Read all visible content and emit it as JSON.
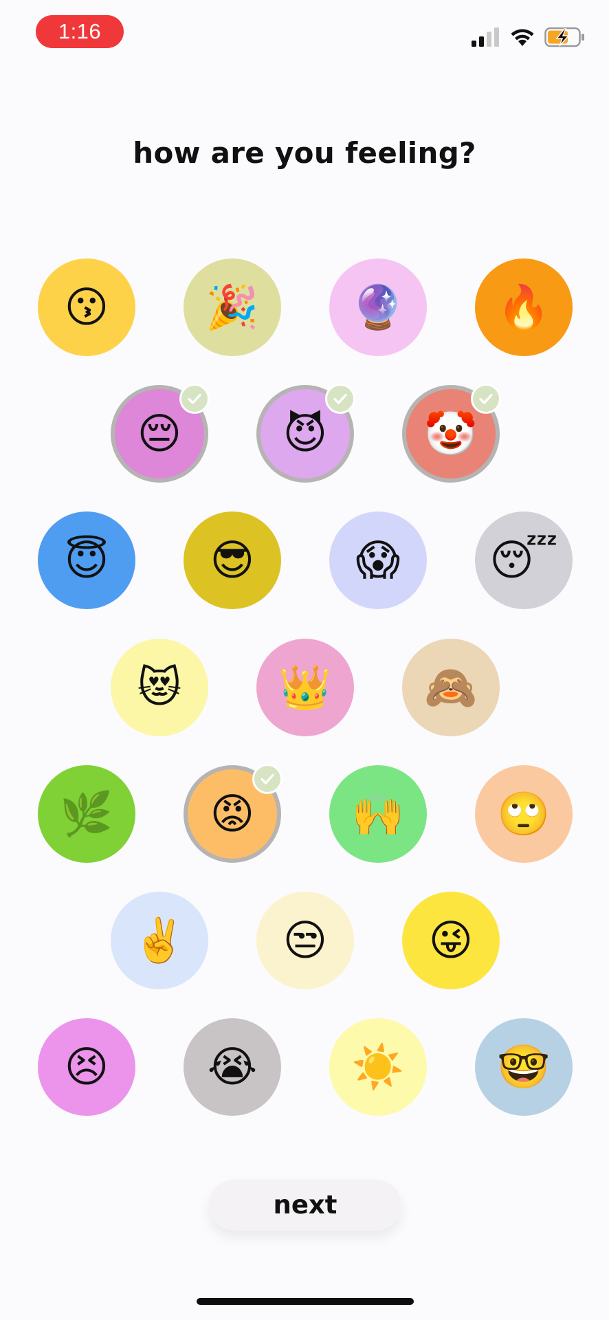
{
  "status_bar": {
    "time": "1:16",
    "signal_icon": "cellular-signal-icon",
    "wifi_icon": "wifi-icon",
    "battery_icon": "battery-charging-icon",
    "battery_color": "#f5a623"
  },
  "title": "how are you feeling?",
  "moods": [
    {
      "emoji": "😗",
      "name": "kissing-face",
      "color": "#fdd249",
      "selected": false
    },
    {
      "emoji": "🎉",
      "name": "party-popper",
      "color": "#dede9e",
      "selected": false
    },
    {
      "emoji": "🔮",
      "name": "crystal-ball",
      "color": "#f5c4f3",
      "selected": false
    },
    {
      "emoji": "🔥",
      "name": "fire",
      "color": "#f89a14",
      "selected": false
    },
    {
      "emoji": "😔",
      "name": "pensive-face",
      "color": "#de86d8",
      "selected": true
    },
    {
      "emoji": "😈",
      "name": "smiling-devil",
      "color": "#dda8ee",
      "selected": true
    },
    {
      "emoji": "🤡",
      "name": "clown-face",
      "color": "#e98375",
      "selected": true
    },
    {
      "emoji": "😇",
      "name": "halo-face",
      "color": "#4f9df1",
      "selected": false
    },
    {
      "emoji": "😎",
      "name": "sunglasses-face",
      "color": "#dcc223",
      "selected": false
    },
    {
      "emoji": "😱",
      "name": "screaming-face",
      "color": "#d2d6fa",
      "selected": false
    },
    {
      "emoji": "😴",
      "name": "sleeping-face",
      "color": "#d2d1d7",
      "selected": false
    },
    {
      "emoji": "😻",
      "name": "heart-eyes-cat",
      "color": "#fbf7a6",
      "selected": false
    },
    {
      "emoji": "👑",
      "name": "crown",
      "color": "#eea5cf",
      "selected": false
    },
    {
      "emoji": "🙈",
      "name": "see-no-evil-monkey",
      "color": "#ebd6b6",
      "selected": false
    },
    {
      "emoji": "🌿",
      "name": "herb",
      "color": "#7fd135",
      "selected": false
    },
    {
      "emoji": "😡",
      "name": "angry-face",
      "color": "#fcbd66",
      "selected": true
    },
    {
      "emoji": "🙌",
      "name": "raising-hands",
      "color": "#7be584",
      "selected": false
    },
    {
      "emoji": "🙄",
      "name": "eye-roll-face",
      "color": "#fbc9a0",
      "selected": false
    },
    {
      "emoji": "✌️",
      "name": "victory-hand",
      "color": "#d9e5fb",
      "selected": false
    },
    {
      "emoji": "😒",
      "name": "unamused-face",
      "color": "#faf3cd",
      "selected": false
    },
    {
      "emoji": "😜",
      "name": "winking-tongue-face",
      "color": "#fde53f",
      "selected": false
    },
    {
      "emoji": "😣",
      "name": "persevering-face",
      "color": "#ec93ec",
      "selected": false
    },
    {
      "emoji": "😭",
      "name": "crying-face",
      "color": "#c8c4c6",
      "selected": false
    },
    {
      "emoji": "☀️",
      "name": "sun",
      "color": "#fdfaab",
      "selected": false
    },
    {
      "emoji": "🤓",
      "name": "nerd-face",
      "color": "#b6d1e3",
      "selected": false
    }
  ],
  "selected_badge": {
    "icon": "check-icon",
    "color": "#d6e4c4"
  },
  "next_button": {
    "label": "next"
  }
}
